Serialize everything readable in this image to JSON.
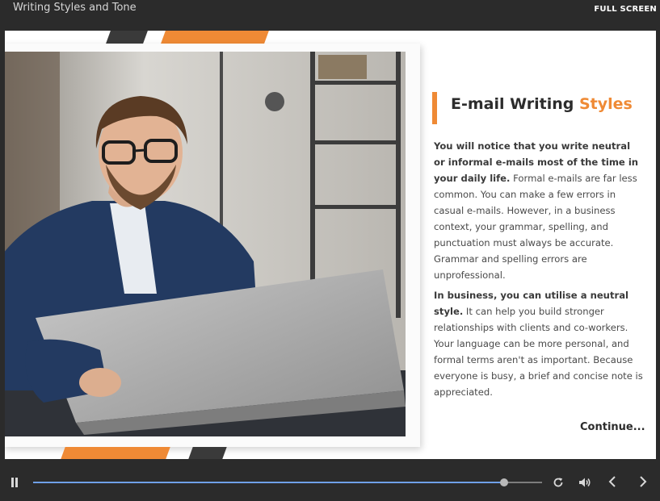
{
  "window": {
    "title": "Writing Styles and Tone",
    "fullscreen_label": "FULL SCREEN"
  },
  "slide": {
    "heading_main": "E-mail Writing",
    "heading_accent": "Styles",
    "paragraphs": [
      {
        "lead": "You will notice that you write neutral or informal e-mails most of the time in your daily life.",
        "text": " Formal e-mails are far less common. You can make a few errors in casual e-mails. However, in a business context, your grammar, spelling, and punctuation must always be accurate. Grammar and spelling errors are unprofessional."
      },
      {
        "lead": "In business, you can utilise a neutral style.",
        "text": " It can help you build stronger relationships with clients and co-workers. Your language can be more personal, and formal terms aren't as important. Because everyone is busy, a brief and concise note is appreciated."
      }
    ],
    "continue_label": "Continue..."
  },
  "player": {
    "progress": 0.925,
    "icons": {
      "pause": "pause-icon",
      "replay": "replay-icon",
      "volume": "volume-icon",
      "previous": "chevron-left-icon",
      "next": "chevron-right-icon"
    }
  },
  "colors": {
    "accent": "#ef8a35",
    "dark": "#2b2b2b",
    "seek_fill": "#6fa0e8"
  }
}
